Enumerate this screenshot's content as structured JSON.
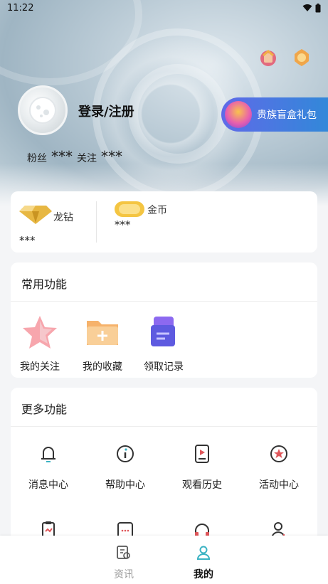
{
  "status_bar": {
    "time": "11:22"
  },
  "profile": {
    "login_label": "登录/注册",
    "fans_label": "粉丝",
    "fans_value": "***",
    "follow_label": "关注",
    "follow_value": "***"
  },
  "promo": {
    "label": "贵族盲盒礼包"
  },
  "wallet": {
    "diamond_label": "龙钻",
    "diamond_value": "***",
    "coin_label": "金币",
    "coin_value": "***"
  },
  "common_functions": {
    "title": "常用功能",
    "items": [
      {
        "label": "我的关注",
        "icon": "star-icon"
      },
      {
        "label": "我的收藏",
        "icon": "folder-icon"
      },
      {
        "label": "领取记录",
        "icon": "record-icon"
      }
    ]
  },
  "more_functions": {
    "title": "更多功能",
    "items": [
      {
        "label": "消息中心",
        "icon": "bell-icon"
      },
      {
        "label": "帮助中心",
        "icon": "info-icon"
      },
      {
        "label": "观看历史",
        "icon": "history-icon"
      },
      {
        "label": "活动中心",
        "icon": "activity-icon"
      }
    ],
    "partial_icons": [
      "clipboard-icon",
      "message-icon",
      "headset-icon",
      "user-add-icon"
    ]
  },
  "tabbar": {
    "tabs": [
      {
        "label": "资讯",
        "active": false
      },
      {
        "label": "我的",
        "active": true
      }
    ]
  },
  "colors": {
    "accent": "#3bb3c3",
    "promo_start": "#5f6ae8",
    "promo_end": "#2f8ad8"
  }
}
